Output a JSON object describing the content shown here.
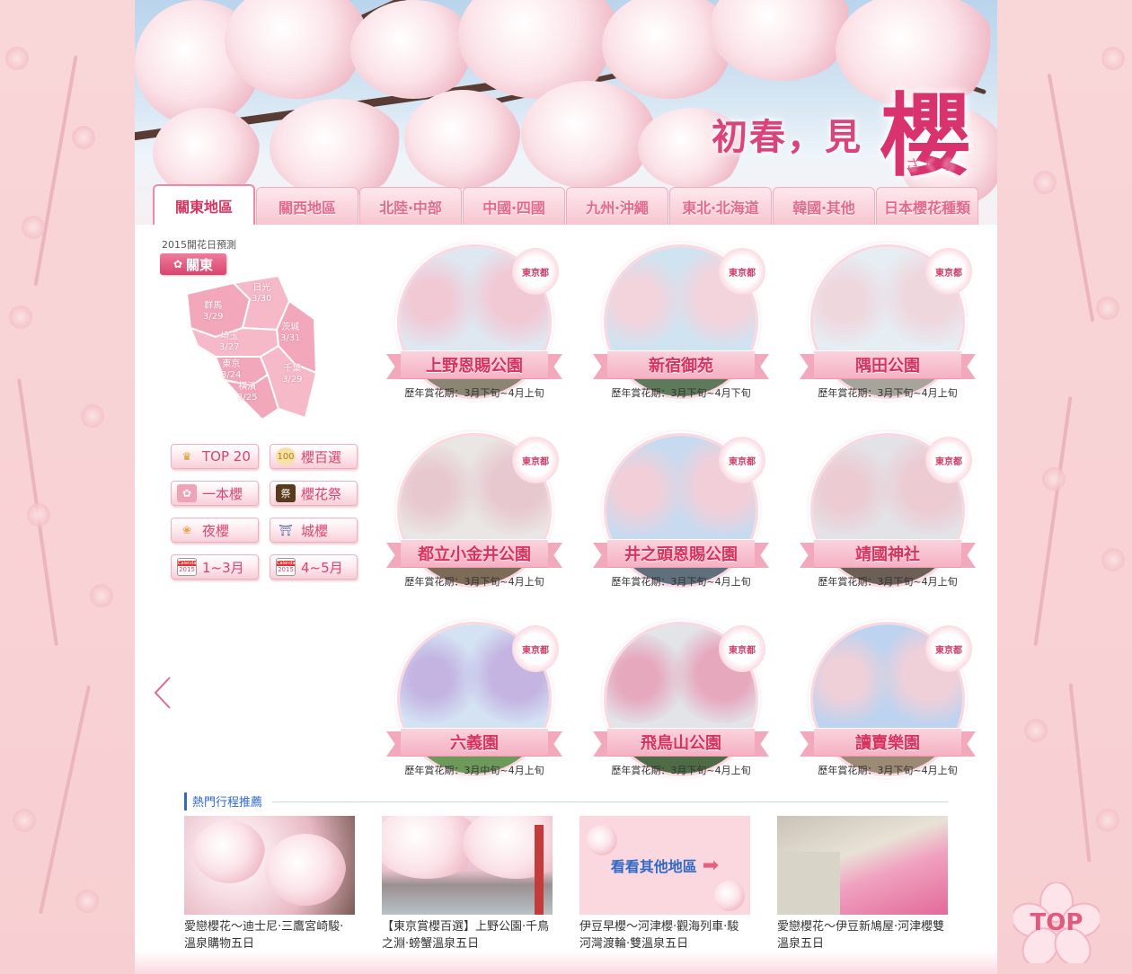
{
  "banner": {
    "title": "初春，見",
    "big_char": "櫻",
    "kana": "さくら"
  },
  "tabs": [
    {
      "label": "關東地區",
      "active": true
    },
    {
      "label": "關西地區",
      "active": false
    },
    {
      "label": "北陸‧中部",
      "active": false
    },
    {
      "label": "中國‧四國",
      "active": false
    },
    {
      "label": "九州‧沖繩",
      "active": false
    },
    {
      "label": "東北‧北海道",
      "active": false
    },
    {
      "label": "韓國‧其他",
      "active": false
    },
    {
      "label": "日本櫻花種類",
      "active": false
    }
  ],
  "forecast": {
    "label": "2015開花日預測",
    "region": "關東",
    "cities": [
      {
        "name": "日光",
        "date": "3/30"
      },
      {
        "name": "群馬",
        "date": "3/29"
      },
      {
        "name": "茨城",
        "date": "3/31"
      },
      {
        "name": "埼玉",
        "date": "3/27"
      },
      {
        "name": "東京",
        "date": "3/24"
      },
      {
        "name": "千葉",
        "date": "3/29"
      },
      {
        "name": "橫濱",
        "date": "3/25"
      }
    ]
  },
  "categories": [
    {
      "label": "TOP 20",
      "icon": "crown-icon"
    },
    {
      "label": "櫻百選",
      "icon": "100-badge-icon"
    },
    {
      "label": "一本櫻",
      "icon": "tree-icon"
    },
    {
      "label": "櫻花祭",
      "icon": "festival-icon"
    },
    {
      "label": "夜櫻",
      "icon": "night-blossom-icon"
    },
    {
      "label": "城櫻",
      "icon": "castle-icon"
    },
    {
      "label": "1~3月",
      "icon": "calendar-icon",
      "calendar_year": "2015"
    },
    {
      "label": "4~5月",
      "icon": "calendar-icon",
      "calendar_year": "2015"
    }
  ],
  "spots": [
    {
      "name": "上野恩賜公園",
      "pref": "東京都",
      "period": "歷年賞花期：3月下旬~4月上旬"
    },
    {
      "name": "新宿御苑",
      "pref": "東京都",
      "period": "歷年賞花期：3月下旬~4月下旬"
    },
    {
      "name": "隅田公園",
      "pref": "東京都",
      "period": "歷年賞花期：3月下旬~4月上旬"
    },
    {
      "name": "都立小金井公園",
      "pref": "東京都",
      "period": "歷年賞花期：3月下旬~4月上旬"
    },
    {
      "name": "井之頭恩賜公園",
      "pref": "東京都",
      "period": "歷年賞花期：3月下旬~4月上旬"
    },
    {
      "name": "靖國神社",
      "pref": "東京都",
      "period": "歷年賞花期：3月下旬~4月上旬"
    },
    {
      "name": "六義園",
      "pref": "東京都",
      "period": "歷年賞花期：3月中旬~4月上旬"
    },
    {
      "name": "飛鳥山公園",
      "pref": "東京都",
      "period": "歷年賞花期：3月下旬~4月上旬"
    },
    {
      "name": "讀賣樂園",
      "pref": "東京都",
      "period": "歷年賞花期：3月下旬~4月上旬"
    }
  ],
  "hot": {
    "title": "熱門行程推薦",
    "items": [
      {
        "caption": "愛戀櫻花～迪士尼‧三鷹宮崎駿‧溫泉購物五日"
      },
      {
        "caption": "【東京賞櫻百選】上野公園‧千鳥之淵‧螃蟹溫泉五日"
      },
      {
        "caption": "伊豆早櫻～河津櫻‧觀海列車‧駿河灣渡輪‧雙溫泉五日",
        "overlay": "看看其他地區"
      },
      {
        "caption": "愛戀櫻花～伊豆新鳩屋‧河津櫻雙溫泉五日"
      }
    ]
  },
  "top_button": "TOP",
  "colors": {
    "accent": "#d8335f",
    "tab_text": "#e26a8e",
    "link_blue": "#2f69c7"
  }
}
